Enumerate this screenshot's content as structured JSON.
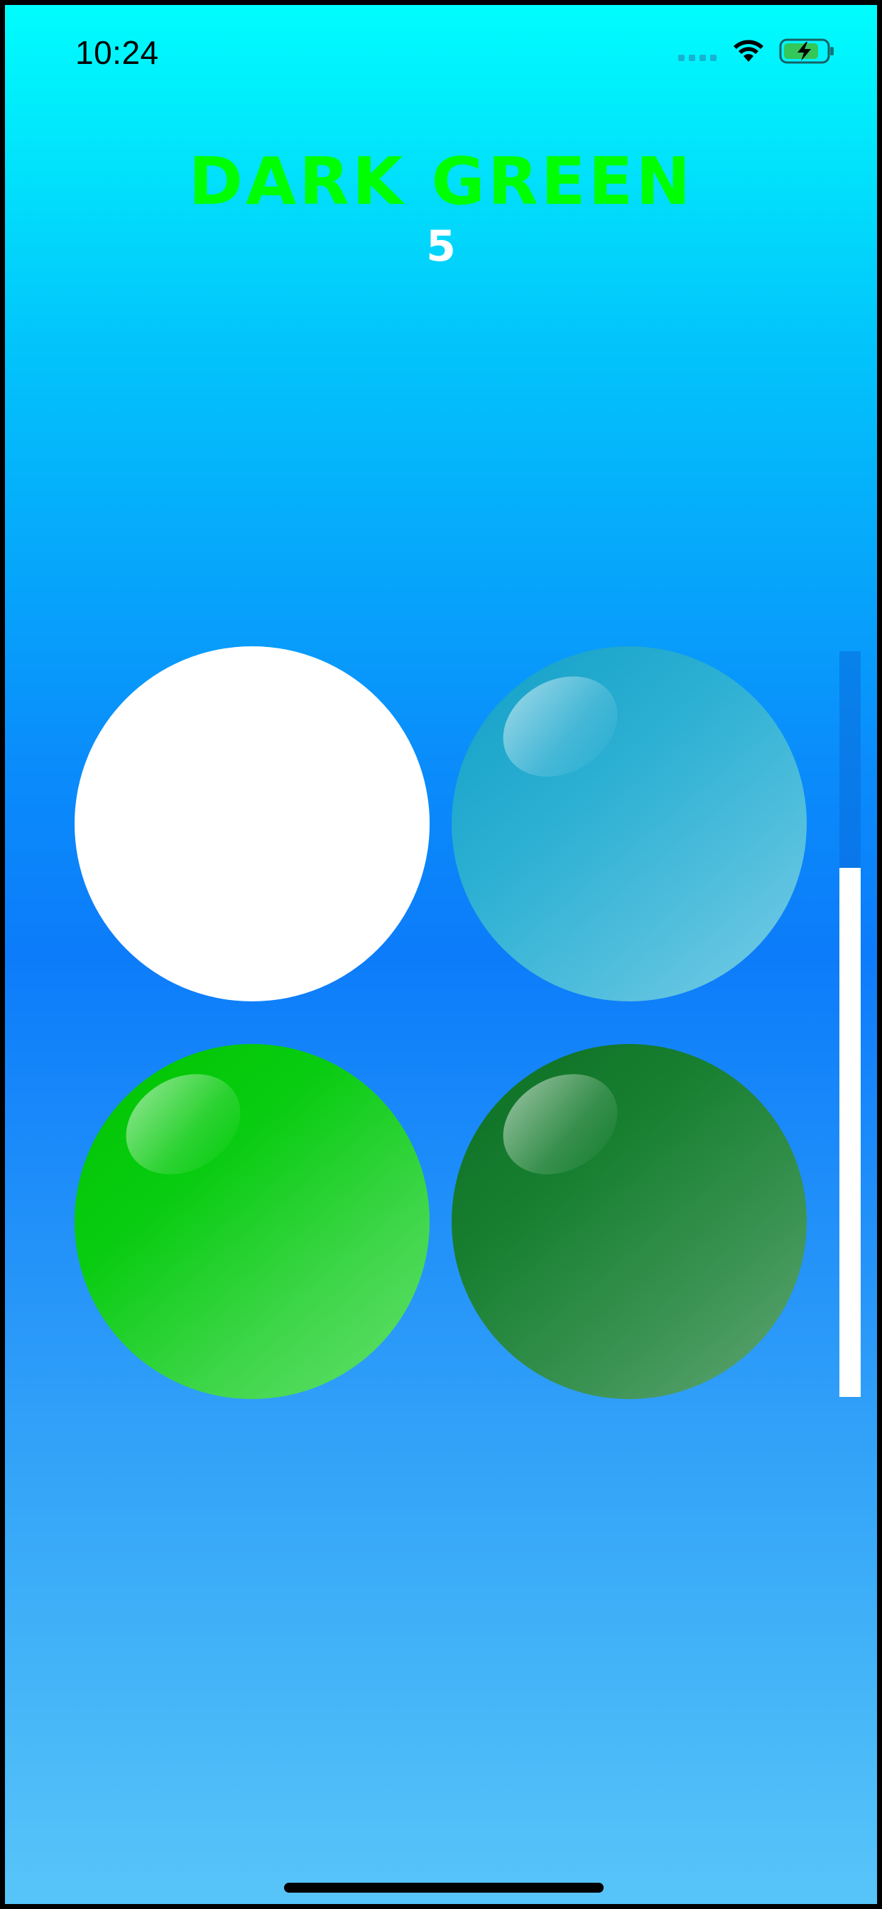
{
  "status_bar": {
    "time": "10:24",
    "signal_icon": "cellular-signal-icon",
    "wifi_icon": "wifi-icon",
    "battery_icon": "battery-charging-icon",
    "battery_color": "#34c759"
  },
  "game": {
    "target_word": "DARK GREEN",
    "target_word_color": "#00ff00",
    "score": "5",
    "timer_fraction_remaining": 0.71
  },
  "orbs": [
    {
      "name": "white",
      "color": "#ffffff"
    },
    {
      "name": "light-blue",
      "color": "#2cb0d3"
    },
    {
      "name": "green",
      "color": "#08cc10"
    },
    {
      "name": "dark-green",
      "color": "#177f30"
    }
  ],
  "colors": {
    "background_top": "#00fdfd",
    "background_middle": "#0c7cfa",
    "background_bottom": "#58c5f9"
  }
}
